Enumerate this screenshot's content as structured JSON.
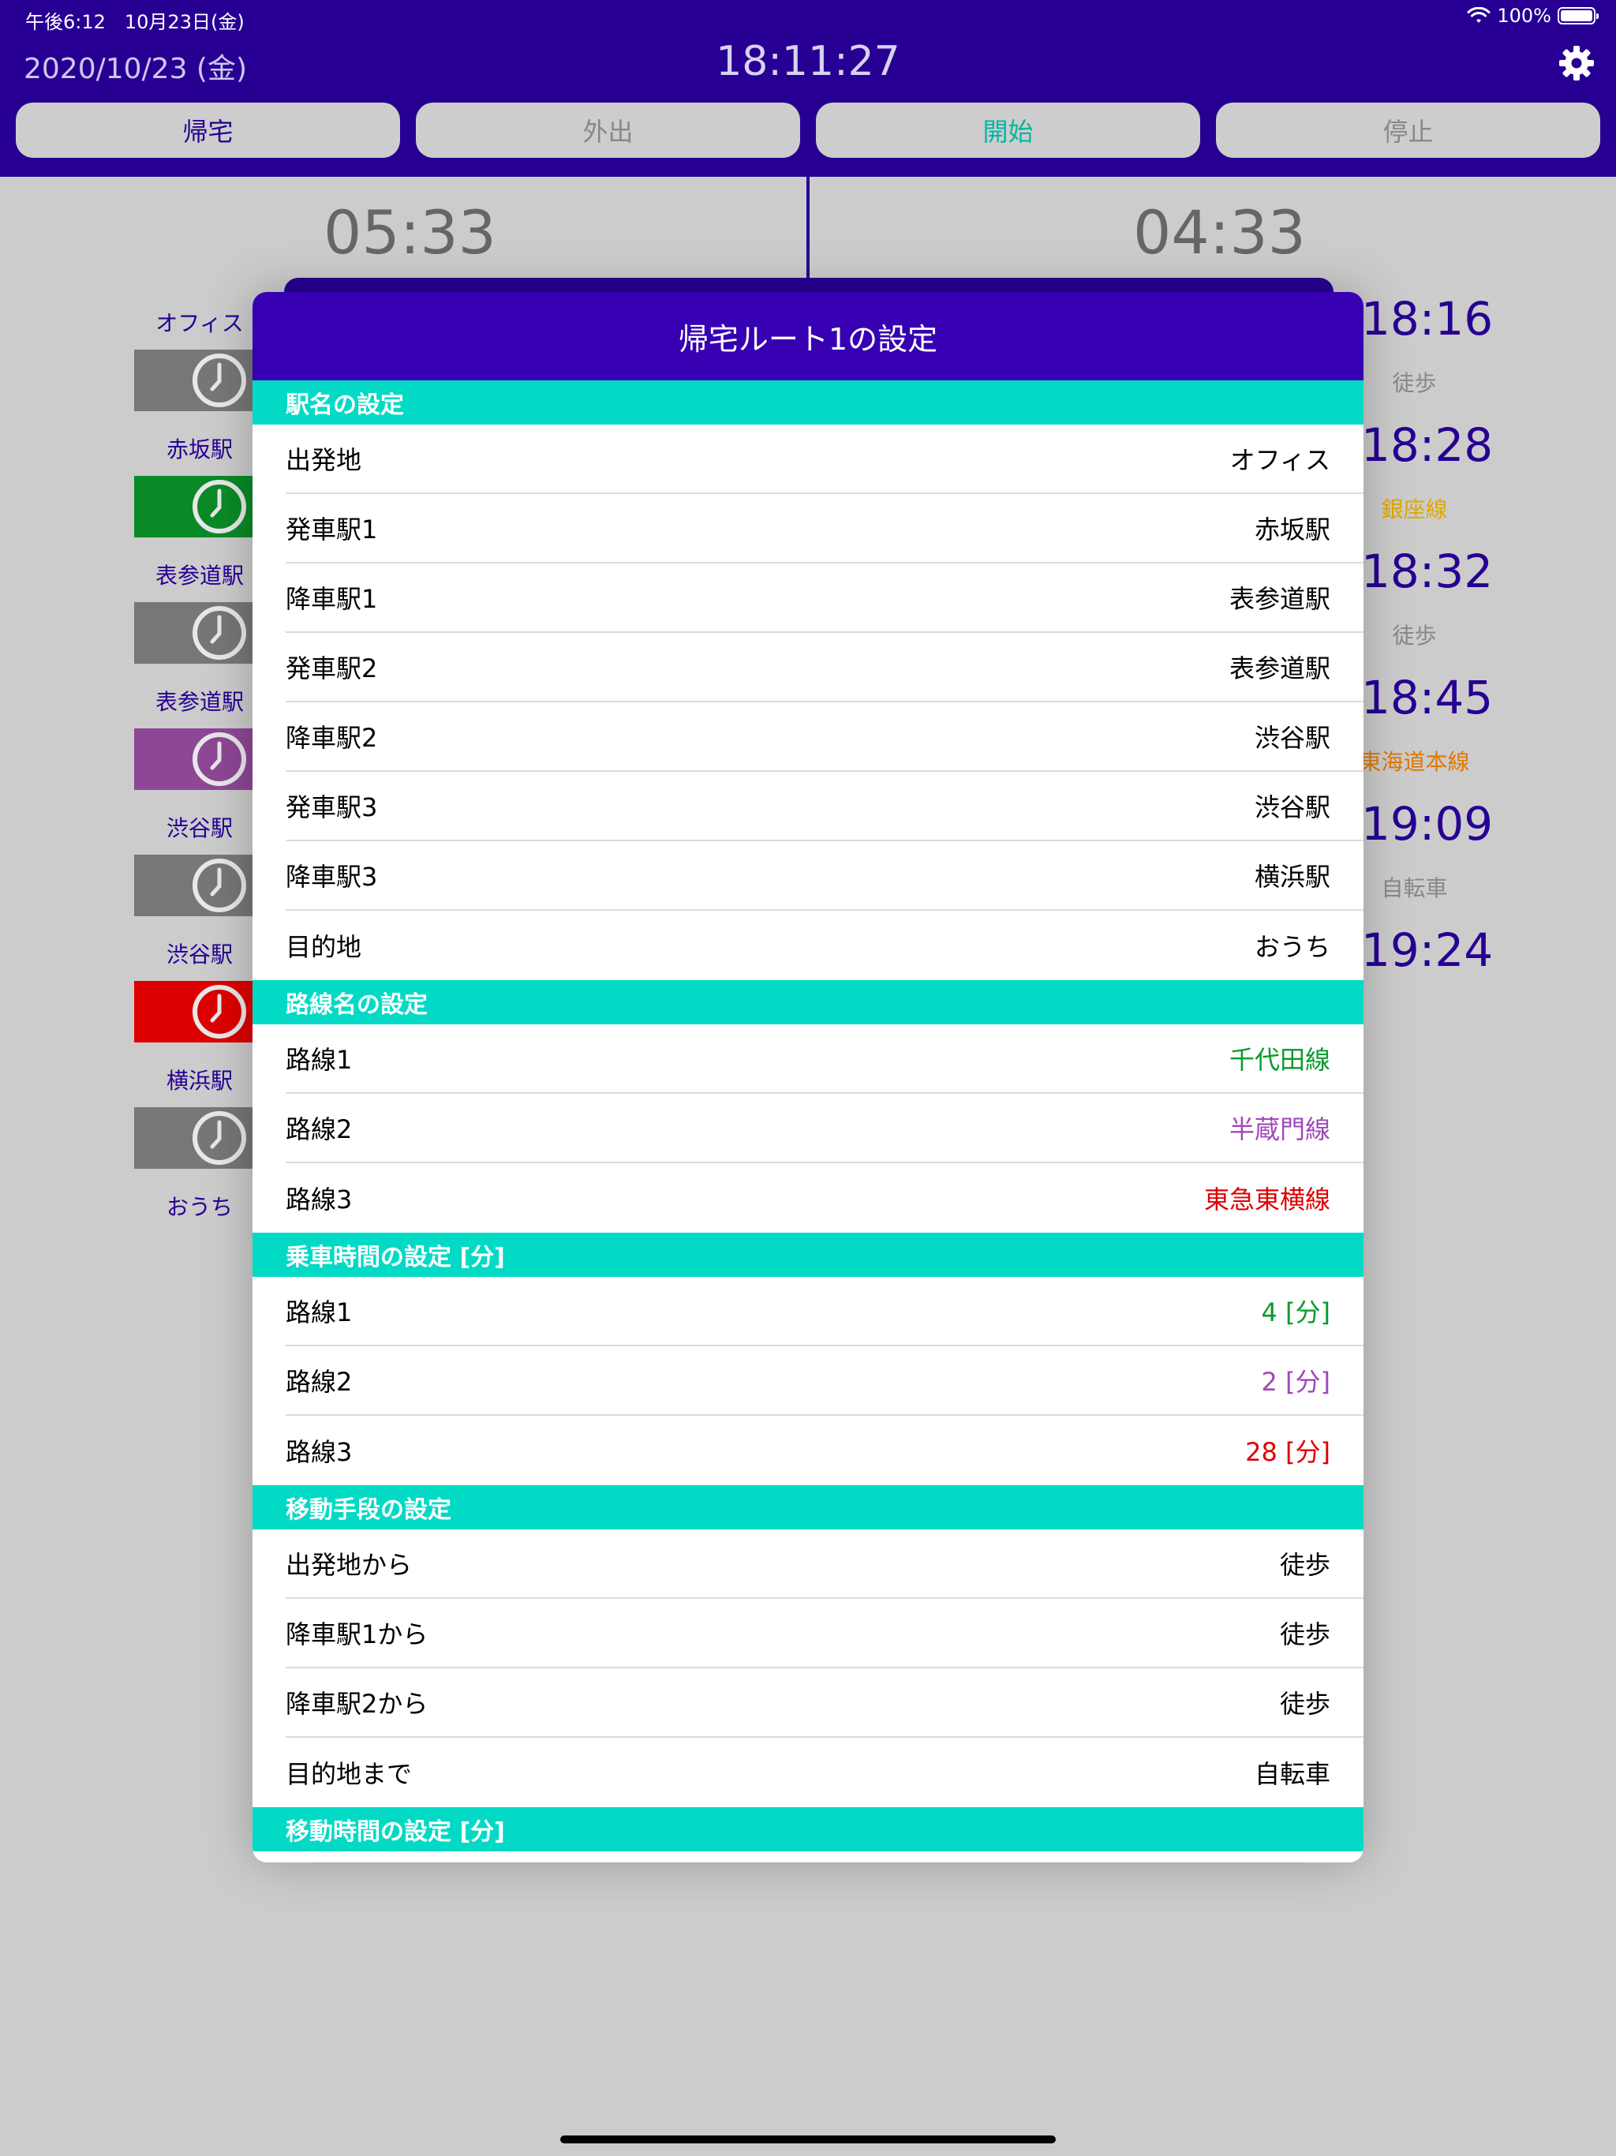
{
  "status_bar": {
    "time": "午後6:12　10月23日(金)",
    "battery": "100%"
  },
  "header": {
    "date": "2020/10/23 (金)",
    "clock": "18:11:27",
    "buttons": [
      {
        "label": "帰宅",
        "color": "#270093"
      },
      {
        "label": "外出",
        "color": "#888888"
      },
      {
        "label": "開始",
        "color": "#03b5a5"
      },
      {
        "label": "停止",
        "color": "#888888"
      }
    ]
  },
  "main": {
    "left_count": "05:33",
    "right_count": "04:33",
    "left_stations": [
      {
        "label": "オフィス",
        "block_color": "#777777"
      },
      {
        "label": "赤坂駅",
        "block_color": "#0a8a27"
      },
      {
        "label": "表参道駅",
        "block_color": "#777777"
      },
      {
        "label": "表参道駅",
        "block_color": "#8e4796"
      },
      {
        "label": "渋谷駅",
        "block_color": "#777777"
      },
      {
        "label": "渋谷駅",
        "block_color": "#dd0000"
      },
      {
        "label": "横浜駅",
        "block_color": "#777777"
      },
      {
        "label": "おうち",
        "block_color": null
      }
    ],
    "right_times": [
      "18:16",
      "18:28",
      "18:32",
      "18:45",
      "19:09",
      "19:24"
    ],
    "right_modes": [
      {
        "label": "徒歩",
        "color": "#888888"
      },
      {
        "label": "銀座線",
        "color": "#e0a800"
      },
      {
        "label": "徒歩",
        "color": "#888888"
      },
      {
        "label": "東海道本線",
        "color": "#e07800"
      },
      {
        "label": "自転車",
        "color": "#888888"
      }
    ]
  },
  "modal": {
    "title": "帰宅ルート1の設定",
    "sections": [
      {
        "title": "駅名の設定",
        "rows": [
          {
            "label": "出発地",
            "value": "オフィス",
            "color": "#000000"
          },
          {
            "label": "発車駅1",
            "value": "赤坂駅",
            "color": "#000000"
          },
          {
            "label": "降車駅1",
            "value": "表参道駅",
            "color": "#000000"
          },
          {
            "label": "発車駅2",
            "value": "表参道駅",
            "color": "#000000"
          },
          {
            "label": "降車駅2",
            "value": "渋谷駅",
            "color": "#000000"
          },
          {
            "label": "発車駅3",
            "value": "渋谷駅",
            "color": "#000000"
          },
          {
            "label": "降車駅3",
            "value": "横浜駅",
            "color": "#000000"
          },
          {
            "label": "目的地",
            "value": "おうち",
            "color": "#000000"
          }
        ]
      },
      {
        "title": "路線名の設定",
        "rows": [
          {
            "label": "路線1",
            "value": "千代田線",
            "color": "#0a9a2c"
          },
          {
            "label": "路線2",
            "value": "半蔵門線",
            "color": "#a048b8"
          },
          {
            "label": "路線3",
            "value": "東急東横線",
            "color": "#e00000"
          }
        ]
      },
      {
        "title": "乗車時間の設定 [分]",
        "rows": [
          {
            "label": "路線1",
            "value": "4 [分]",
            "color": "#0a9a2c"
          },
          {
            "label": "路線2",
            "value": "2 [分]",
            "color": "#a048b8"
          },
          {
            "label": "路線3",
            "value": "28 [分]",
            "color": "#e00000"
          }
        ]
      },
      {
        "title": "移動手段の設定",
        "rows": [
          {
            "label": "出発地から",
            "value": "徒歩",
            "color": "#000000"
          },
          {
            "label": "降車駅1から",
            "value": "徒歩",
            "color": "#000000"
          },
          {
            "label": "降車駅2から",
            "value": "徒歩",
            "color": "#000000"
          },
          {
            "label": "目的地まで",
            "value": "自転車",
            "color": "#000000"
          }
        ]
      },
      {
        "title": "移動時間の設定 [分]",
        "rows": []
      }
    ]
  },
  "icons": {
    "wifi": "wifi-icon",
    "battery": "battery-icon",
    "settings": "gear-icon",
    "clock": "clock-icon"
  }
}
